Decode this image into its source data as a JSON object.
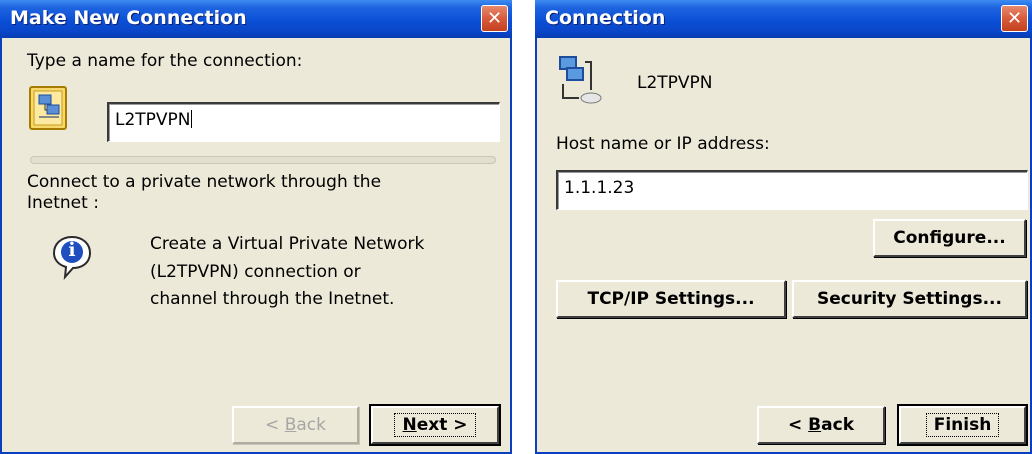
{
  "wizard": {
    "title": "Make New Connection",
    "prompt": "Type a name for the connection:",
    "name_value": "L2TPVPN",
    "description_line1": "Connect to a private network through the",
    "description_line2": "Inetnet :",
    "info_line1": "Create a Virtual Private Network",
    "info_line2": "(L2TPVPN) connection or",
    "info_line3": "channel through the Inetnet.",
    "back_label": "< Back",
    "back_accel": "B",
    "next_label": "Next >",
    "next_accel": "N",
    "close_glyph": "✕",
    "info_glyph": "i"
  },
  "connection": {
    "title": "Connection",
    "connection_name": "L2TPVPN",
    "host_label": "Host name or IP address:",
    "host_value": "1.1.1.23",
    "configure_label": "Configure...",
    "tcpip_label": "TCP/IP Settings...",
    "security_label": "Security Settings...",
    "back_label": "< Back",
    "finish_label": "Finish",
    "close_glyph": "✕"
  },
  "colors": {
    "titlebar": "#0a4fd6",
    "window_bg": "#ece9d8",
    "close_button": "#d75b3b"
  },
  "icons": [
    "connection-folder-icon",
    "info-icon",
    "network-computer-icon",
    "close-icon"
  ]
}
